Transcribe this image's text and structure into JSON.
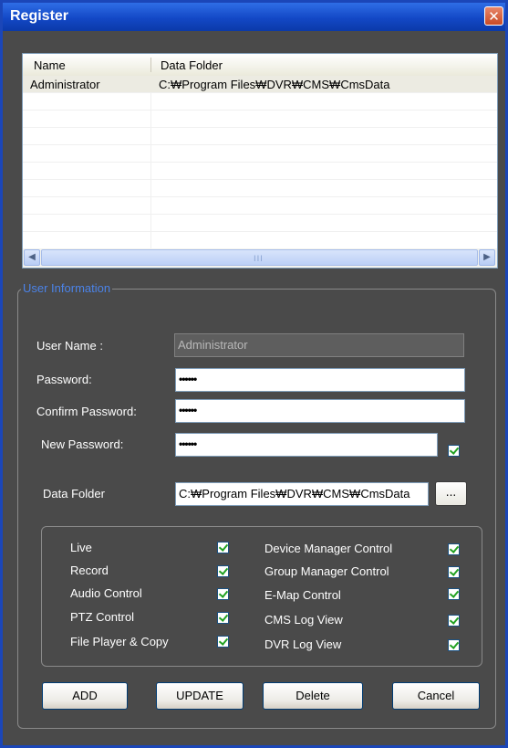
{
  "window": {
    "title": "Register"
  },
  "list": {
    "columns": [
      "Name",
      "Data Folder"
    ],
    "rows": [
      {
        "name": "Administrator",
        "folder": "C:₩Program Files₩DVR₩CMS₩CmsData"
      }
    ],
    "scroll_grip": "III"
  },
  "user_info": {
    "group_label": "User Information",
    "user_name_label": "User Name :",
    "user_name_value": "Administrator",
    "password_label": "Password:",
    "password_value": "••••••",
    "confirm_label": "Confirm Password:",
    "confirm_value": "••••••",
    "new_password_label": "New Password:",
    "new_password_value": "••••••",
    "new_password_checked": true,
    "data_folder_label": "Data Folder",
    "data_folder_value": "C:₩Program Files₩DVR₩CMS₩CmsData",
    "browse_label": "..."
  },
  "permissions": {
    "left": [
      {
        "label": "Live",
        "checked": true
      },
      {
        "label": "Record",
        "checked": true
      },
      {
        "label": "Audio Control",
        "checked": true
      },
      {
        "label": "PTZ Control",
        "checked": true
      },
      {
        "label": "File Player & Copy",
        "checked": true
      }
    ],
    "right": [
      {
        "label": "Device Manager Control",
        "checked": true
      },
      {
        "label": "Group Manager Control",
        "checked": true
      },
      {
        "label": "E-Map Control",
        "checked": true
      },
      {
        "label": "CMS Log View",
        "checked": true
      },
      {
        "label": "DVR Log View",
        "checked": true
      }
    ]
  },
  "buttons": {
    "add": "ADD",
    "update": "UPDATE",
    "delete": "Delete",
    "cancel": "Cancel"
  },
  "colors": {
    "title_bar": "#1348c6",
    "dialog_bg": "#4a4a4a",
    "group_label": "#4b83e8",
    "check": "#21a121"
  }
}
